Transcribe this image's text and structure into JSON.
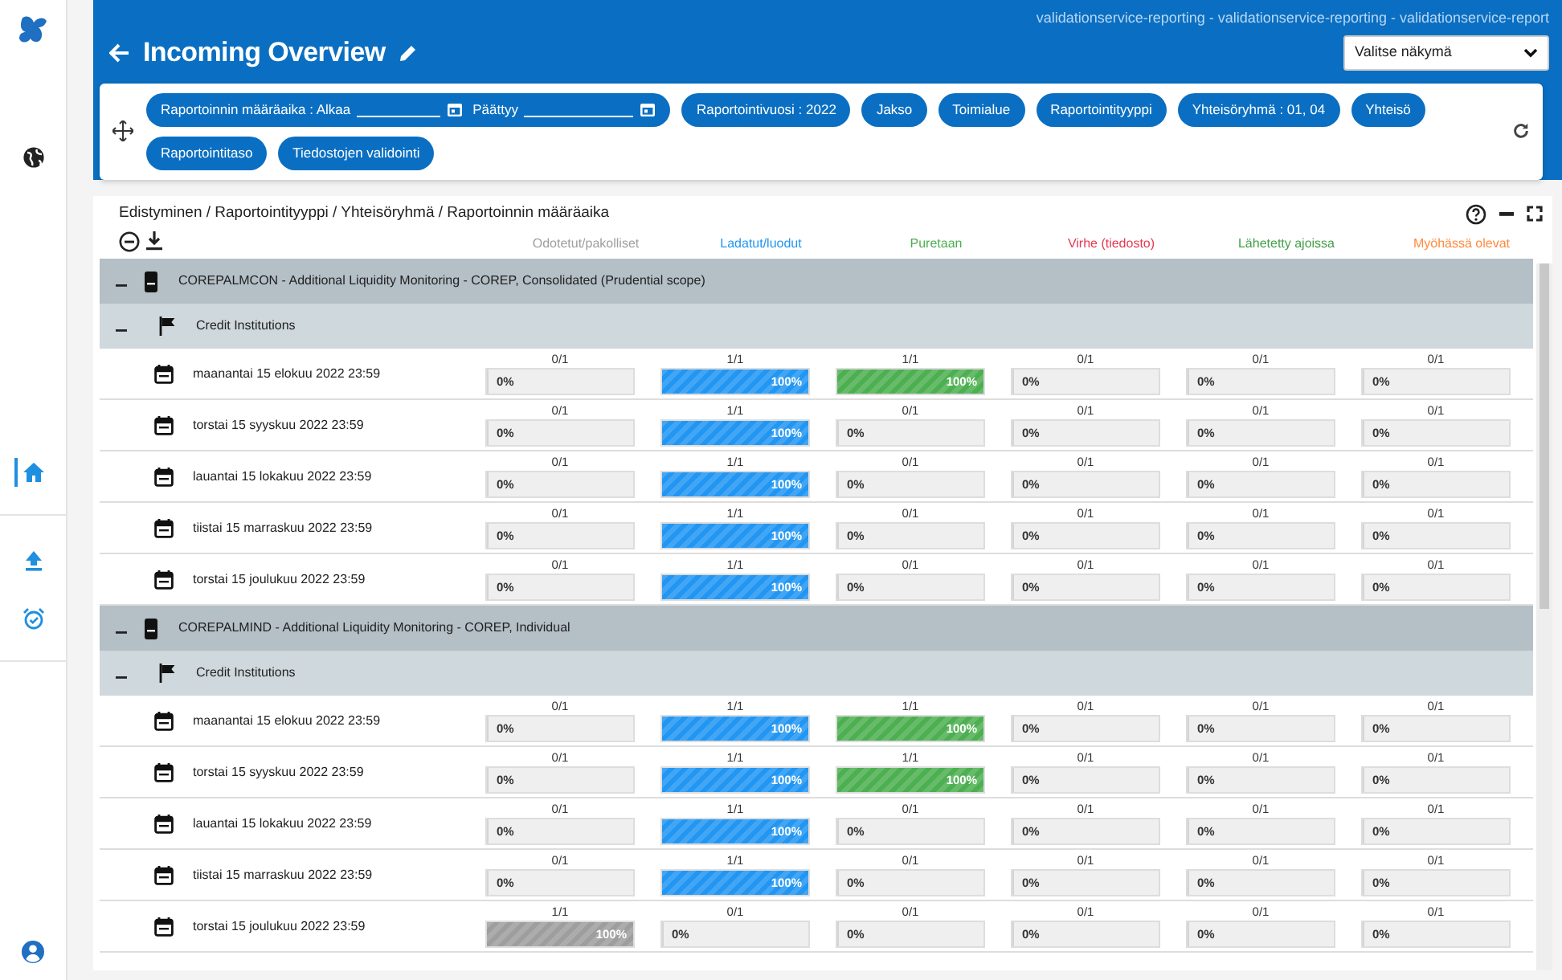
{
  "sidebar": {
    "items": [
      {
        "kind": "globe",
        "selected": false
      },
      {
        "kind": "home",
        "selected": true
      },
      {
        "kind": "upload",
        "selected": false
      },
      {
        "kind": "alarm",
        "selected": false
      }
    ]
  },
  "header": {
    "title": "Incoming Overview",
    "environment": "validationservice-reporting - validationservice-reporting - validationservice-report",
    "view_select": "Valitse näkymä"
  },
  "filters": [
    {
      "kind": "date_range",
      "start_label": "Raportoinnin määräaika : Alkaa",
      "end_label": "Päättyy"
    },
    {
      "kind": "chip",
      "label": "Raportointivuosi : 2022"
    },
    {
      "kind": "chip",
      "label": "Jakso"
    },
    {
      "kind": "chip",
      "label": "Toimialue"
    },
    {
      "kind": "chip",
      "label": "Raportointityyppi"
    },
    {
      "kind": "chip",
      "label": "Yhteisöryhmä : 01, 04"
    },
    {
      "kind": "chip",
      "label": "Yhteisö"
    },
    {
      "kind": "chip",
      "label": "Raportointitaso"
    },
    {
      "kind": "chip",
      "label": "Tiedostojen validointi"
    }
  ],
  "table": {
    "title": "Edistyminen / Raportointityyppi / Yhteisöryhmä / Raportoinnin määräaika",
    "columns": [
      {
        "label": "Odotetut/pakolliset",
        "color": "#9e9e9e"
      },
      {
        "label": "Ladatut/luodut",
        "color": "#2196f3"
      },
      {
        "label": "Puretaan",
        "color": "#4caf50"
      },
      {
        "label": "Virhe (tiedosto)",
        "color": "#e53950"
      },
      {
        "label": "Lähetetty ajoissa",
        "color": "#43a047"
      },
      {
        "label": "Myöhässä olevat",
        "color": "#ff8a3d"
      }
    ],
    "groups": [
      {
        "title": "COREPALMCON - Additional Liquidity Monitoring - COREP, Consolidated (Prudential scope)",
        "expanded": true,
        "subgroups": [
          {
            "title": "Credit Institutions",
            "expanded": true,
            "rows": [
              {
                "date": "maanantai 15 elokuu 2022 23:59",
                "cells": [
                  {
                    "count": "0/1",
                    "level": 0,
                    "reading": "0%"
                  },
                  {
                    "count": "1/1",
                    "level": 1,
                    "reading": "100%"
                  },
                  {
                    "count": "1/1",
                    "level": 1,
                    "reading": "100%"
                  },
                  {
                    "count": "0/1",
                    "level": 0,
                    "reading": "0%"
                  },
                  {
                    "count": "0/1",
                    "level": 0,
                    "reading": "0%"
                  },
                  {
                    "count": "0/1",
                    "level": 0,
                    "reading": "0%"
                  }
                ]
              },
              {
                "date": "torstai 15 syyskuu 2022 23:59",
                "cells": [
                  {
                    "count": "0/1",
                    "level": 0,
                    "reading": "0%"
                  },
                  {
                    "count": "1/1",
                    "level": 1,
                    "reading": "100%"
                  },
                  {
                    "count": "0/1",
                    "level": 0,
                    "reading": "0%"
                  },
                  {
                    "count": "0/1",
                    "level": 0,
                    "reading": "0%"
                  },
                  {
                    "count": "0/1",
                    "level": 0,
                    "reading": "0%"
                  },
                  {
                    "count": "0/1",
                    "level": 0,
                    "reading": "0%"
                  }
                ]
              },
              {
                "date": "lauantai 15 lokakuu 2022 23:59",
                "cells": [
                  {
                    "count": "0/1",
                    "level": 0,
                    "reading": "0%"
                  },
                  {
                    "count": "1/1",
                    "level": 1,
                    "reading": "100%"
                  },
                  {
                    "count": "0/1",
                    "level": 0,
                    "reading": "0%"
                  },
                  {
                    "count": "0/1",
                    "level": 0,
                    "reading": "0%"
                  },
                  {
                    "count": "0/1",
                    "level": 0,
                    "reading": "0%"
                  },
                  {
                    "count": "0/1",
                    "level": 0,
                    "reading": "0%"
                  }
                ]
              },
              {
                "date": "tiistai 15 marraskuu 2022 23:59",
                "cells": [
                  {
                    "count": "0/1",
                    "level": 0,
                    "reading": "0%"
                  },
                  {
                    "count": "1/1",
                    "level": 1,
                    "reading": "100%"
                  },
                  {
                    "count": "0/1",
                    "level": 0,
                    "reading": "0%"
                  },
                  {
                    "count": "0/1",
                    "level": 0,
                    "reading": "0%"
                  },
                  {
                    "count": "0/1",
                    "level": 0,
                    "reading": "0%"
                  },
                  {
                    "count": "0/1",
                    "level": 0,
                    "reading": "0%"
                  }
                ]
              },
              {
                "date": "torstai 15 joulukuu 2022 23:59",
                "cells": [
                  {
                    "count": "0/1",
                    "level": 0,
                    "reading": "0%"
                  },
                  {
                    "count": "1/1",
                    "level": 1,
                    "reading": "100%"
                  },
                  {
                    "count": "0/1",
                    "level": 0,
                    "reading": "0%"
                  },
                  {
                    "count": "0/1",
                    "level": 0,
                    "reading": "0%"
                  },
                  {
                    "count": "0/1",
                    "level": 0,
                    "reading": "0%"
                  },
                  {
                    "count": "0/1",
                    "level": 0,
                    "reading": "0%"
                  }
                ]
              }
            ]
          }
        ]
      },
      {
        "title": "COREPALMIND - Additional Liquidity Monitoring - COREP, Individual",
        "expanded": true,
        "subgroups": [
          {
            "title": "Credit Institutions",
            "expanded": true,
            "rows": [
              {
                "date": "maanantai 15 elokuu 2022 23:59",
                "cells": [
                  {
                    "count": "0/1",
                    "level": 0,
                    "reading": "0%"
                  },
                  {
                    "count": "1/1",
                    "level": 1,
                    "reading": "100%"
                  },
                  {
                    "count": "1/1",
                    "level": 1,
                    "reading": "100%"
                  },
                  {
                    "count": "0/1",
                    "level": 0,
                    "reading": "0%"
                  },
                  {
                    "count": "0/1",
                    "level": 0,
                    "reading": "0%"
                  },
                  {
                    "count": "0/1",
                    "level": 0,
                    "reading": "0%"
                  }
                ]
              },
              {
                "date": "torstai 15 syyskuu 2022 23:59",
                "cells": [
                  {
                    "count": "0/1",
                    "level": 0,
                    "reading": "0%"
                  },
                  {
                    "count": "1/1",
                    "level": 1,
                    "reading": "100%"
                  },
                  {
                    "count": "1/1",
                    "level": 1,
                    "reading": "100%"
                  },
                  {
                    "count": "0/1",
                    "level": 0,
                    "reading": "0%"
                  },
                  {
                    "count": "0/1",
                    "level": 0,
                    "reading": "0%"
                  },
                  {
                    "count": "0/1",
                    "level": 0,
                    "reading": "0%"
                  }
                ]
              },
              {
                "date": "lauantai 15 lokakuu 2022 23:59",
                "cells": [
                  {
                    "count": "0/1",
                    "level": 0,
                    "reading": "0%"
                  },
                  {
                    "count": "1/1",
                    "level": 1,
                    "reading": "100%"
                  },
                  {
                    "count": "0/1",
                    "level": 0,
                    "reading": "0%"
                  },
                  {
                    "count": "0/1",
                    "level": 0,
                    "reading": "0%"
                  },
                  {
                    "count": "0/1",
                    "level": 0,
                    "reading": "0%"
                  },
                  {
                    "count": "0/1",
                    "level": 0,
                    "reading": "0%"
                  }
                ]
              },
              {
                "date": "tiistai 15 marraskuu 2022 23:59",
                "cells": [
                  {
                    "count": "0/1",
                    "level": 0,
                    "reading": "0%"
                  },
                  {
                    "count": "1/1",
                    "level": 1,
                    "reading": "100%"
                  },
                  {
                    "count": "0/1",
                    "level": 0,
                    "reading": "0%"
                  },
                  {
                    "count": "0/1",
                    "level": 0,
                    "reading": "0%"
                  },
                  {
                    "count": "0/1",
                    "level": 0,
                    "reading": "0%"
                  },
                  {
                    "count": "0/1",
                    "level": 0,
                    "reading": "0%"
                  }
                ]
              },
              {
                "date": "torstai 15 joulukuu 2022 23:59",
                "cells": [
                  {
                    "count": "1/1",
                    "level": 1,
                    "reading": "100%"
                  },
                  {
                    "count": "0/1",
                    "level": 0,
                    "reading": "0%"
                  },
                  {
                    "count": "0/1",
                    "level": 0,
                    "reading": "0%"
                  },
                  {
                    "count": "0/1",
                    "level": 0,
                    "reading": "0%"
                  },
                  {
                    "count": "0/1",
                    "level": 0,
                    "reading": "0%"
                  },
                  {
                    "count": "0/1",
                    "level": 0,
                    "reading": "0%"
                  }
                ]
              }
            ]
          }
        ]
      }
    ]
  }
}
